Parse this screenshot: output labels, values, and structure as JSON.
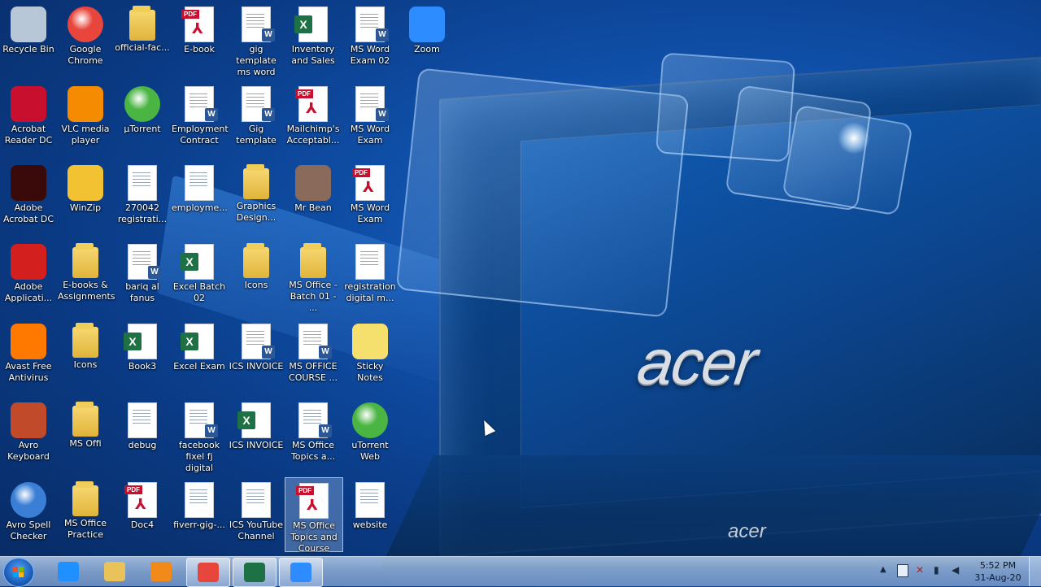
{
  "wallpaper": {
    "brand_large": "acer",
    "brand_small": "acer"
  },
  "desktop_icons": [
    {
      "label": "Recycle Bin",
      "type": "app",
      "name": "recycle-bin-icon",
      "color": "#b8c7d8"
    },
    {
      "label": "Google Chrome",
      "type": "round",
      "name": "chrome-icon",
      "color": "#e8453c"
    },
    {
      "label": "official-fac...",
      "type": "folder",
      "name": "folder-icon"
    },
    {
      "label": "E-book",
      "type": "pdf",
      "name": "pdf-icon"
    },
    {
      "label": "gig template ms word",
      "type": "word",
      "name": "word-doc-icon"
    },
    {
      "label": "Inventory and Sales",
      "type": "excel",
      "name": "excel-icon"
    },
    {
      "label": "MS Word Exam 02",
      "type": "word",
      "name": "word-doc-icon"
    },
    {
      "label": "Zoom",
      "type": "app",
      "name": "zoom-icon",
      "color": "#2d8cff"
    },
    {
      "label": "Acrobat Reader DC",
      "type": "app",
      "name": "acrobat-reader-icon",
      "color": "#c8102e"
    },
    {
      "label": "VLC media player",
      "type": "app",
      "name": "vlc-icon",
      "color": "#f48b00"
    },
    {
      "label": "µTorrent",
      "type": "round",
      "name": "utorrent-icon",
      "color": "#4bb543"
    },
    {
      "label": "Employment Contract",
      "type": "word",
      "name": "word-doc-icon"
    },
    {
      "label": "Gig template",
      "type": "word",
      "name": "word-doc-icon"
    },
    {
      "label": "Mailchimp's Acceptabl...",
      "type": "pdf",
      "name": "pdf-icon"
    },
    {
      "label": "MS Word Exam",
      "type": "word",
      "name": "word-doc-icon"
    },
    {
      "label": "Adobe Acrobat DC",
      "type": "app",
      "name": "acrobat-dc-icon",
      "color": "#3a0a0a"
    },
    {
      "label": "WinZip",
      "type": "app",
      "name": "winzip-icon",
      "color": "#f2c232"
    },
    {
      "label": "270042 registrati...",
      "type": "blank",
      "name": "document-icon"
    },
    {
      "label": "employme...",
      "type": "blank",
      "name": "document-icon"
    },
    {
      "label": "Graphics Design...",
      "type": "folder",
      "name": "folder-icon"
    },
    {
      "label": "Mr Bean",
      "type": "app",
      "name": "image-icon",
      "color": "#8a6a5a"
    },
    {
      "label": "MS Word Exam",
      "type": "pdf",
      "name": "pdf-icon"
    },
    {
      "label": "Adobe Applicati...",
      "type": "app",
      "name": "adobe-app-icon",
      "color": "#d41f1f"
    },
    {
      "label": "E-books & Assignments",
      "type": "folder",
      "name": "folder-icon"
    },
    {
      "label": "bariq al fanus",
      "type": "word",
      "name": "word-doc-icon"
    },
    {
      "label": "Excel Batch 02",
      "type": "excel",
      "name": "excel-icon"
    },
    {
      "label": "Icons",
      "type": "folder",
      "name": "folder-icon"
    },
    {
      "label": "MS Office - Batch 01 - ...",
      "type": "folder",
      "name": "folder-icon"
    },
    {
      "label": "registration digital m...",
      "type": "blank",
      "name": "document-icon"
    },
    {
      "label": "Avast Free Antivirus",
      "type": "app",
      "name": "avast-icon",
      "color": "#ff7800"
    },
    {
      "label": "Icons",
      "type": "folder",
      "name": "folder-icon"
    },
    {
      "label": "Book3",
      "type": "excel",
      "name": "excel-icon"
    },
    {
      "label": "Excel Exam",
      "type": "excel",
      "name": "excel-icon"
    },
    {
      "label": "ICS INVOICE",
      "type": "word",
      "name": "word-doc-icon"
    },
    {
      "label": "MS OFFICE COURSE ...",
      "type": "word",
      "name": "word-doc-icon"
    },
    {
      "label": "Sticky Notes",
      "type": "app",
      "name": "sticky-notes-icon",
      "color": "#f5e06e"
    },
    {
      "label": "Avro Keyboard",
      "type": "app",
      "name": "avro-keyboard-icon",
      "color": "#c04a2a"
    },
    {
      "label": "MS Offi",
      "type": "folder",
      "name": "folder-icon"
    },
    {
      "label": "debug",
      "type": "blank",
      "name": "document-icon"
    },
    {
      "label": "facebook fixel fj digital",
      "type": "word",
      "name": "word-doc-icon"
    },
    {
      "label": "ICS INVOICE",
      "type": "excel",
      "name": "excel-icon"
    },
    {
      "label": "MS Office Topics a...",
      "type": "word",
      "name": "word-doc-icon"
    },
    {
      "label": "uTorrent Web",
      "type": "round",
      "name": "utorrent-web-icon",
      "color": "#4bb543"
    },
    {
      "label": "Avro Spell Checker",
      "type": "round",
      "name": "avro-spell-checker-icon",
      "color": "#3a7fd5"
    },
    {
      "label": "MS Office Practice",
      "type": "folder",
      "name": "folder-icon"
    },
    {
      "label": "Doc4",
      "type": "pdf",
      "name": "pdf-icon"
    },
    {
      "label": "fiverr-gig-...",
      "type": "blank",
      "name": "document-icon"
    },
    {
      "label": "ICS YouTube Channel",
      "type": "blank",
      "name": "document-icon"
    },
    {
      "label": "MS Office Topics and Course",
      "type": "pdf",
      "name": "pdf-icon",
      "selected": true
    },
    {
      "label": "website",
      "type": "blank",
      "name": "document-icon"
    }
  ],
  "taskbar": {
    "pinned": [
      {
        "name": "internet-explorer-icon",
        "color": "#1e90ff"
      },
      {
        "name": "file-explorer-icon",
        "color": "#e9c35a"
      },
      {
        "name": "media-player-icon",
        "color": "#f28a1a"
      },
      {
        "name": "chrome-taskbar-icon",
        "color": "#e8453c",
        "active": true
      },
      {
        "name": "excel-taskbar-icon",
        "color": "#1e7145",
        "active": true
      },
      {
        "name": "zoom-taskbar-icon",
        "color": "#2d8cff",
        "active": true
      }
    ],
    "clock": {
      "time": "5:52 PM",
      "date": "31-Aug-20"
    }
  }
}
